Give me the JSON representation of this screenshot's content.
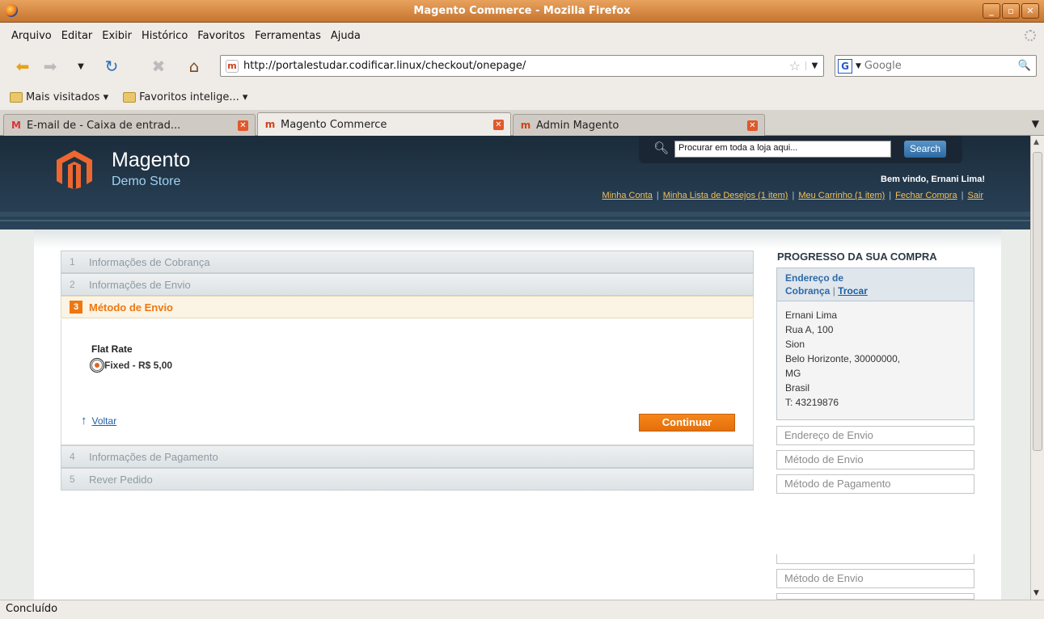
{
  "window": {
    "title": "Magento Commerce - Mozilla Firefox"
  },
  "menu": [
    "Arquivo",
    "Editar",
    "Exibir",
    "Histórico",
    "Favoritos",
    "Ferramentas",
    "Ajuda"
  ],
  "nav": {
    "url": "http://portalestudar.codificar.linux/checkout/onepage/",
    "search_placeholder": "Google"
  },
  "bookmarks": [
    "Mais visitados ▾",
    "Favoritos intelige... ▾"
  ],
  "tabs": [
    {
      "label": "E-mail de  - Caixa de entrad..."
    },
    {
      "label": "Magento Commerce"
    },
    {
      "label": "Admin Magento"
    }
  ],
  "store": {
    "brand": "Magento",
    "subtitle": "Demo Store",
    "search_placeholder": "Procurar em toda a loja aqui...",
    "search_button": "Search",
    "welcome": "Bem vindo, Ernani Lima!",
    "links": [
      "Minha Conta",
      "Minha Lista de Desejos (1 item)",
      "Meu Carrinho (1 item)",
      "Fechar Compra",
      "Sair"
    ]
  },
  "checkout": {
    "steps": [
      {
        "num": "1",
        "label": "Informações de Cobrança"
      },
      {
        "num": "2",
        "label": "Informações de Envio"
      },
      {
        "num": "3",
        "label": "Método de Envio"
      },
      {
        "num": "4",
        "label": "Informações de Pagamento"
      },
      {
        "num": "5",
        "label": "Rever Pedido"
      }
    ],
    "shipping_group": "Flat Rate",
    "shipping_option": "Fixed - R$ 5,00",
    "back_label": "Voltar",
    "continue_label": "Continuar"
  },
  "progress": {
    "title": "PROGRESSO DA SUA COMPRA",
    "billing_head_line1": "Endereço de",
    "billing_head_line2": "Cobrança",
    "change_label": "Trocar",
    "address": [
      "Ernani Lima",
      "Rua A, 100",
      "Sion",
      "Belo Horizonte, 30000000,",
      "MG",
      "Brasil",
      "T: 43219876"
    ],
    "items": [
      "Endereço de Envio",
      "Método de Envio",
      "Método de Pagamento"
    ],
    "repeat_item": "Método de Envio"
  },
  "status": "Concluído"
}
